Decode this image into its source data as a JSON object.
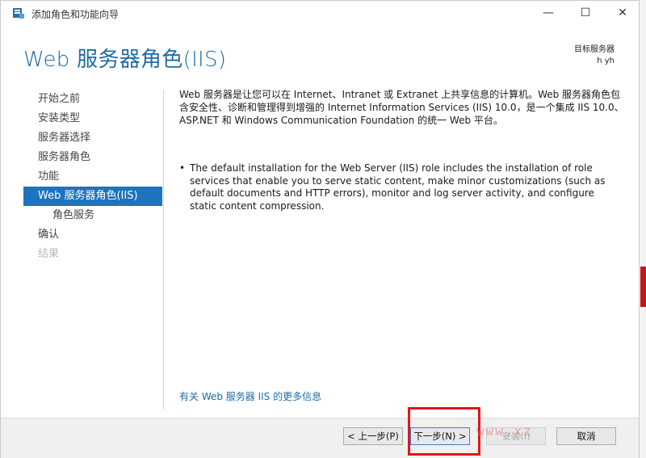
{
  "window": {
    "title": "添加角色和功能向导",
    "minimize_symbol": "—",
    "maximize_symbol": "☐",
    "close_symbol": "✕"
  },
  "header": {
    "page_title": "Web 服务器角色(IIS)",
    "target_label": "目标服务器",
    "target_value": "h        yh"
  },
  "nav": {
    "items": [
      {
        "label": "开始之前",
        "state": "normal"
      },
      {
        "label": "安装类型",
        "state": "normal"
      },
      {
        "label": "服务器选择",
        "state": "normal"
      },
      {
        "label": "服务器角色",
        "state": "normal"
      },
      {
        "label": "功能",
        "state": "normal"
      },
      {
        "label": "Web 服务器角色(IIS)",
        "state": "active"
      },
      {
        "label": "角色服务",
        "state": "sub"
      },
      {
        "label": "确认",
        "state": "normal"
      },
      {
        "label": "结果",
        "state": "disabled"
      }
    ]
  },
  "content": {
    "intro": "Web 服务器是让您可以在 Internet、Intranet 或 Extranet 上共享信息的计算机。Web 服务器角色包含安全性、诊断和管理得到增强的 Internet Information Services (IIS) 10.0，是一个集成 IIS 10.0、ASP.NET 和 Windows Communication Foundation 的统一 Web 平台。",
    "bullet": "The default installation for the Web Server (IIS) role includes the installation of role services that enable you to serve static content, make minor customizations (such as default documents and HTTP errors), monitor and log server activity, and configure static content compression.",
    "more_link": "有关 Web 服务器 IIS 的更多信息"
  },
  "footer": {
    "prev_label": "< 上一步(P)",
    "next_label": "下一步(N) >",
    "install_label": "安装(I)",
    "cancel_label": "取消"
  },
  "watermark": "www.xz",
  "colors": {
    "accent": "#1e73be",
    "title_blue": "#1f6ca6",
    "highlight_red": "#e3151a"
  }
}
